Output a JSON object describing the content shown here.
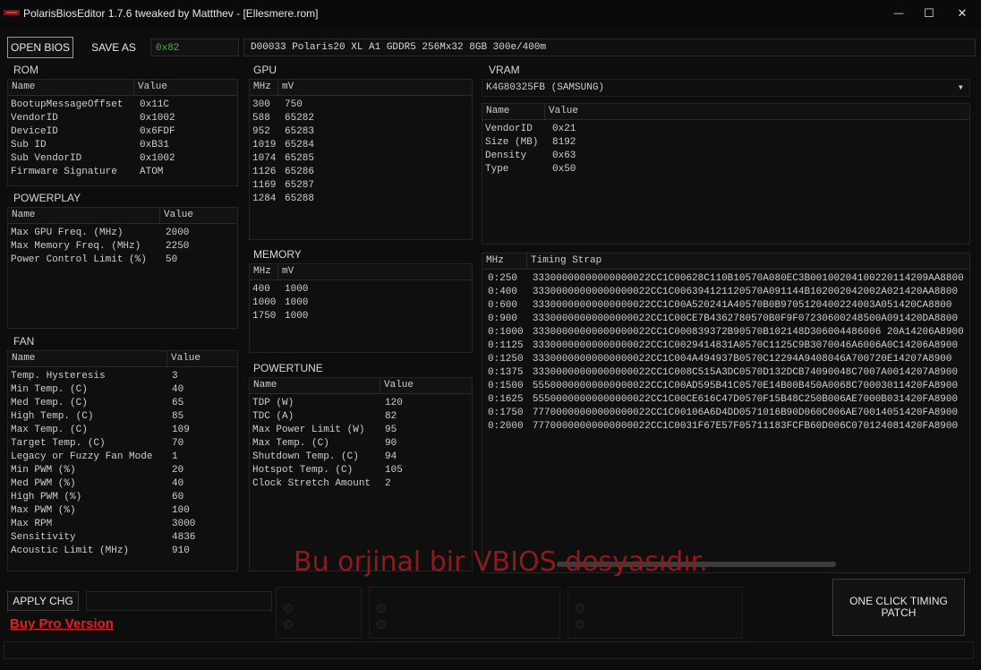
{
  "window": {
    "title": "PolarisBiosEditor 1.7.6 tweaked by Mattthev  - [Ellesmere.rom]",
    "minimize_glyph": "—",
    "maximize_glyph": "☐",
    "close_glyph": "✕"
  },
  "toolbar": {
    "open_label": "OPEN BIOS",
    "save_label": "SAVE AS",
    "hex_value": "0x82",
    "bios_info": "D00033 Polaris20 XL A1 GDDR5 256Mx32 8GB 300e/400m"
  },
  "rom": {
    "title": "ROM",
    "headers": [
      "Name",
      "Value"
    ],
    "rows": [
      [
        "BootupMessageOffset",
        "0x11C"
      ],
      [
        "VendorID",
        "0x1002"
      ],
      [
        "DeviceID",
        "0x6FDF"
      ],
      [
        "Sub ID",
        "0xB31"
      ],
      [
        "Sub VendorID",
        "0x1002"
      ],
      [
        "Firmware Signature",
        "ATOM"
      ]
    ]
  },
  "powerplay": {
    "title": "POWERPLAY",
    "headers": [
      "Name",
      "Value"
    ],
    "rows": [
      [
        "Max GPU Freq. (MHz)",
        "2000"
      ],
      [
        "Max Memory Freq. (MHz)",
        "2250"
      ],
      [
        "Power Control Limit (%)",
        "50"
      ]
    ]
  },
  "fan": {
    "title": "FAN",
    "headers": [
      "Name",
      "Value"
    ],
    "rows": [
      [
        "Temp. Hysteresis",
        "3"
      ],
      [
        "Min Temp. (C)",
        "40"
      ],
      [
        "Med Temp. (C)",
        "65"
      ],
      [
        "High Temp. (C)",
        "85"
      ],
      [
        "Max Temp. (C)",
        "109"
      ],
      [
        "Target Temp. (C)",
        "70"
      ],
      [
        "Legacy or Fuzzy Fan Mode",
        "1"
      ],
      [
        "Min PWM (%)",
        "20"
      ],
      [
        "Med PWM (%)",
        "40"
      ],
      [
        "High PWM (%)",
        "60"
      ],
      [
        "Max PWM (%)",
        "100"
      ],
      [
        "Max RPM",
        "3000"
      ],
      [
        "Sensitivity",
        "4836"
      ],
      [
        "Acoustic Limit (MHz)",
        "910"
      ]
    ]
  },
  "gpu": {
    "title": "GPU",
    "headers": [
      "MHz",
      "mV"
    ],
    "rows": [
      [
        "300",
        "750"
      ],
      [
        "588",
        "65282"
      ],
      [
        "952",
        "65283"
      ],
      [
        "1019",
        "65284"
      ],
      [
        "1074",
        "65285"
      ],
      [
        "1126",
        "65286"
      ],
      [
        "1169",
        "65287"
      ],
      [
        "1284",
        "65288"
      ]
    ]
  },
  "memory": {
    "title": "MEMORY",
    "headers": [
      "MHz",
      "mV"
    ],
    "rows": [
      [
        "400",
        "1000"
      ],
      [
        "1000",
        "1000"
      ],
      [
        "1750",
        "1000"
      ]
    ]
  },
  "powertune": {
    "title": "POWERTUNE",
    "headers": [
      "Name",
      "Value"
    ],
    "rows": [
      [
        "TDP (W)",
        "120"
      ],
      [
        "TDC (A)",
        "82"
      ],
      [
        "Max Power Limit (W)",
        "95"
      ],
      [
        "Max Temp. (C)",
        "90"
      ],
      [
        "Shutdown Temp. (C)",
        "94"
      ],
      [
        "Hotspot Temp. (C)",
        "105"
      ],
      [
        "Clock Stretch Amount",
        "2"
      ]
    ]
  },
  "vram": {
    "title": "VRAM",
    "selected": "K4G80325FB (SAMSUNG)",
    "dropdown_glyph": "▾",
    "headers": [
      "Name",
      "Value"
    ],
    "rows": [
      [
        "VendorID",
        "0x21"
      ],
      [
        "Size (MB)",
        "8192"
      ],
      [
        "Density",
        "0x63"
      ],
      [
        "Type",
        "0x50"
      ]
    ]
  },
  "timings": {
    "headers": [
      "MHz",
      "Timing Strap"
    ],
    "rows": [
      [
        "0:250",
        "33300000000000000022CC1C00628C110B10570A080EC3B00100204100220114209AA8800"
      ],
      [
        "0:400",
        "33300000000000000022CC1C006394121120570A091144B102002042002A021420AA8800"
      ],
      [
        "0:600",
        "33300000000000000022CC1C00A520241A40570B0B9705120400224003A051420CA8800"
      ],
      [
        "0:900",
        "33300000000000000022CC1C00CE7B4362780570B0F9F07230600248500A091420DA8800"
      ],
      [
        "0:1000",
        "33300000000000000022CC1C000839372B90570B102148D306004486006 20A14206A8900"
      ],
      [
        "0:1125",
        "33300000000000000022CC1C0029414831A0570C1125C9B3070046A6006A0C14206A8900"
      ],
      [
        "0:1250",
        "33300000000000000022CC1C004A494937B0570C12294A9408046A700720E14207A8900"
      ],
      [
        "0:1375",
        "33300000000000000022CC1C008C515A3DC0570D132DCB74090048C7007A0014207A8900"
      ],
      [
        "0:1500",
        "55500000000000000022CC1C00AD595B41C0570E14B00B450A0068C70003011420FA8900"
      ],
      [
        "0:1625",
        "55500000000000000022CC1C00CE616C47D0570F15B48C250B006AE7000B031420FA8900"
      ],
      [
        "0:1750",
        "77700000000000000022CC1C00106A6D4DD0571016B90D060C006AE70014051420FA8900"
      ],
      [
        "0:2000",
        "77700000000000000022CC1C0031F67E57F05711183FCFB60D006C070124081420FA8900"
      ]
    ]
  },
  "watermark": "Bu orjinal bir VBIOS dosyasıdır.",
  "bottom": {
    "apply_label": "APPLY CHG",
    "buy_pro": "Buy Pro Version",
    "one_click": "ONE CLICK TIMING PATCH"
  },
  "colors": {
    "background": "#0d0d0d",
    "accent_green": "#3fb64a",
    "watermark_red": "#8c1a1f",
    "link_red": "#e02020"
  }
}
